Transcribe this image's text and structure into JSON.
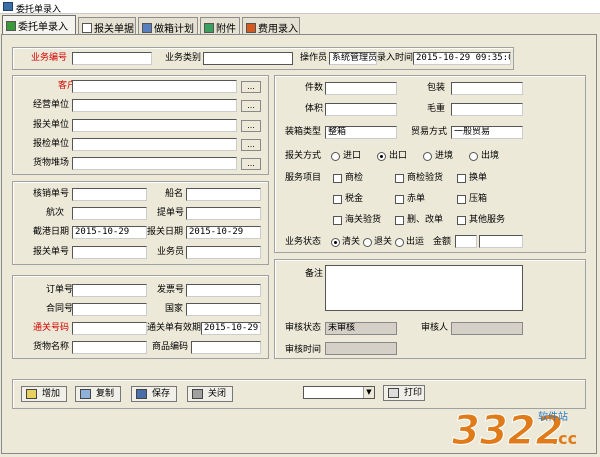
{
  "window": {
    "title": "委托单录入"
  },
  "tabs": [
    {
      "label": "委托单录入"
    },
    {
      "label": "报关单据"
    },
    {
      "label": "做箱计划"
    },
    {
      "label": "附件"
    },
    {
      "label": "费用录入"
    }
  ],
  "header": {
    "business_no_label": "业务编号",
    "business_no_value": "",
    "business_type_label": "业务类别",
    "business_type_value": "",
    "operator_label": "操作员",
    "operator_value": "系统管理员",
    "entry_time_label": "录入时间",
    "entry_time_value": "2015-10-29 09:35:04"
  },
  "parties": {
    "customer_label": "客户",
    "operator_unit_label": "经营单位",
    "declare_unit_label": "报关单位",
    "inspect_unit_label": "报检单位",
    "cargo_yard_label": "货物堆场",
    "ellipsis": "..."
  },
  "shipping": {
    "verification_no_label": "核销单号",
    "ship_name_label": "船名",
    "voyage_label": "航次",
    "bill_no_label": "提单号",
    "port_date_label": "截港日期",
    "port_date_value": "2015-10-29",
    "declare_date_label": "报关日期",
    "declare_date_value": "2015-10-29",
    "declare_no_label": "报关单号",
    "salesman_label": "业务员"
  },
  "order": {
    "order_no_label": "订单号",
    "invoice_no_label": "发票号",
    "contract_no_label": "合同号",
    "country_label": "国家",
    "clearance_no_label": "通关号码",
    "clearance_valid_label": "通关单有效期",
    "clearance_valid_value": "2015-10-29",
    "goods_name_label": "货物名称",
    "goods_code_label": "商品编码"
  },
  "cargo": {
    "pieces_label": "件数",
    "packing_label": "包装",
    "volume_label": "体积",
    "gross_weight_label": "毛重",
    "box_type_label": "装箱类型",
    "box_type_value": "整箱",
    "trade_mode_label": "贸易方式",
    "trade_mode_value": "一般贸易",
    "customs_mode_label": "报关方式",
    "customs_modes": [
      {
        "label": "进口",
        "selected": false
      },
      {
        "label": "出口",
        "selected": true
      },
      {
        "label": "进境",
        "selected": false
      },
      {
        "label": "出境",
        "selected": false
      }
    ],
    "services_label": "服务项目",
    "services": [
      {
        "label": "商检",
        "checked": false
      },
      {
        "label": "商检验货",
        "checked": false
      },
      {
        "label": "换单",
        "checked": false
      },
      {
        "label": "税金",
        "checked": false
      },
      {
        "label": "赤单",
        "checked": false
      },
      {
        "label": "压箱",
        "checked": false
      },
      {
        "label": "海关验货",
        "checked": false
      },
      {
        "label": "删、改单",
        "checked": false
      },
      {
        "label": "其他服务",
        "checked": false
      }
    ],
    "status_label": "业务状态",
    "statuses": [
      {
        "label": "清关",
        "selected": true
      },
      {
        "label": "退关",
        "selected": false
      },
      {
        "label": "出运",
        "selected": false
      }
    ],
    "amount_label": "金额"
  },
  "review": {
    "remark_label": "备注",
    "review_status_label": "审核状态",
    "review_status_value": "未审核",
    "reviewer_label": "审核人",
    "review_time_label": "审核时间"
  },
  "toolbar": {
    "add": "增加",
    "copy": "复制",
    "save": "保存",
    "close": "关闭",
    "print": "打印"
  },
  "watermark": {
    "brand": "3322",
    "suffix": ".cc",
    "sub": "软件站"
  }
}
